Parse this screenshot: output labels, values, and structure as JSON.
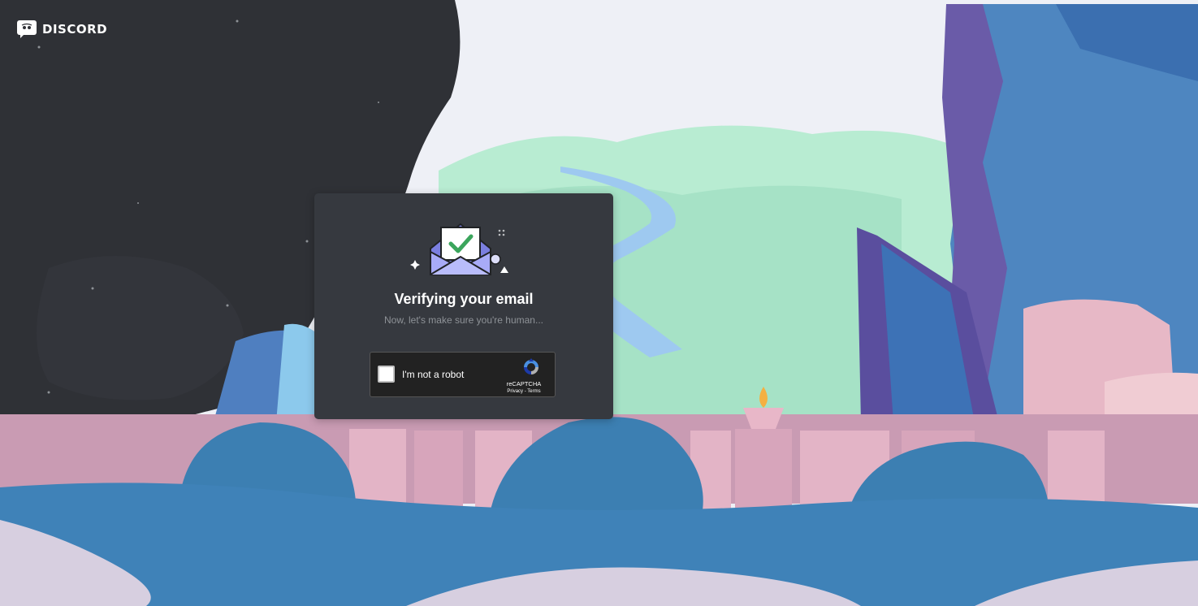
{
  "brand": {
    "logo_text": "DISCORD",
    "color": "#ffffff"
  },
  "card": {
    "title": "Verifying your email",
    "subtitle": "Now, let's make sure you're human...",
    "background": "#36393f",
    "illustration": "envelope-check-icon"
  },
  "recaptcha": {
    "checkbox_label": "I'm not a robot",
    "brand": "reCAPTCHA",
    "privacy_link": "Privacy",
    "separator": " - ",
    "terms_link": "Terms",
    "logo_icon": "recaptcha-logo-icon"
  },
  "colors": {
    "accent": "#5865f2",
    "check_green": "#3ba55c",
    "envelope": "#a8abf7"
  }
}
